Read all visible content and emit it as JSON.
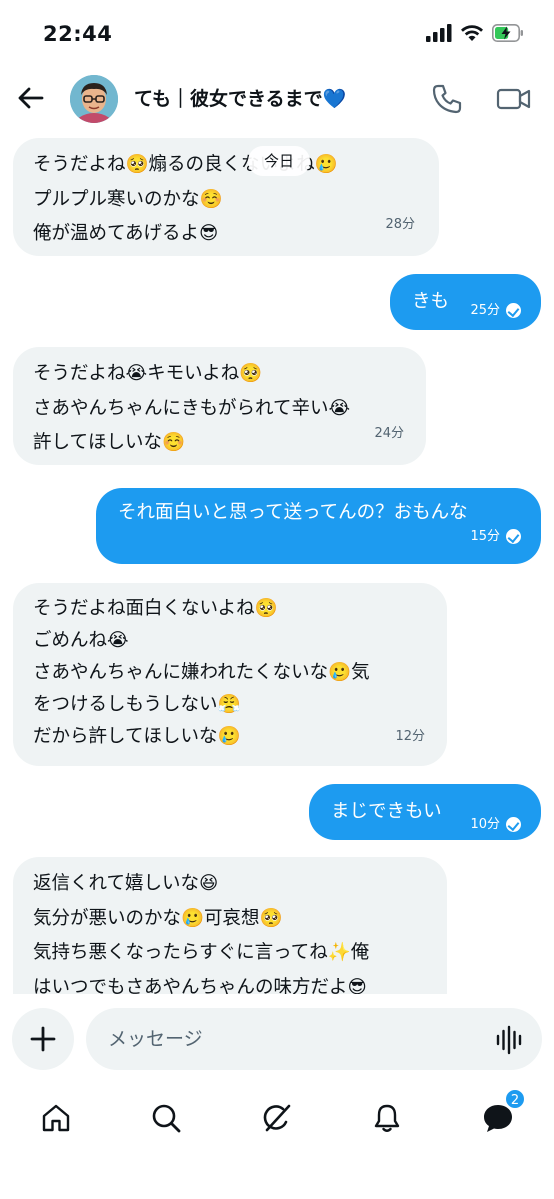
{
  "status_bar": {
    "time": "22:44",
    "battery_level": 0.6
  },
  "header": {
    "title": "ても｜彼女できるまで",
    "title_emoji": "💙",
    "icons": [
      "back-arrow-icon",
      "phone-icon",
      "video-icon"
    ]
  },
  "date_separator": "今日",
  "messages": [
    {
      "direction": "in",
      "lines": [
        "そうだよね🥺煽るの良くないよね🥲",
        "プルプル寒いのかな☺️",
        "俺が温めてあげるよ😎"
      ],
      "time": "28分"
    },
    {
      "direction": "out",
      "lines": [
        "きも"
      ],
      "time": "25分"
    },
    {
      "direction": "in",
      "lines": [
        "そうだよね😭キモいよね🥺",
        "さあやんちゃんにきもがられて辛い😭",
        "許してほしいな☺️"
      ],
      "time": "24分"
    },
    {
      "direction": "out",
      "lines": [
        "それ面白いと思って送ってんの？おもんな"
      ],
      "time": "15分"
    },
    {
      "direction": "in",
      "lines": [
        "そうだよね面白くないよね🥺",
        "ごめんね😭",
        "さあやんちゃんに嫌われたくないな🥲気",
        "をつけるしもうしない😤",
        "だから許してほしいな🥲"
      ],
      "time": "12分"
    },
    {
      "direction": "out",
      "lines": [
        "まじできもい"
      ],
      "time": "10分"
    },
    {
      "direction": "in",
      "lines": [
        "返信くれて嬉しいな😆",
        "気分が悪いのかな🥲可哀想🥺",
        "気持ち悪くなったらすぐに言ってね✨俺",
        "はいつでもさあやんちゃんの味方だよ😎"
      ],
      "time": ""
    }
  ],
  "composer": {
    "placeholder": "メッセージ"
  },
  "tabbar": {
    "items": [
      "home-icon",
      "search-icon",
      "grok-icon",
      "notifications-icon",
      "messages-icon"
    ],
    "messages_badge": "2"
  },
  "colors": {
    "accent": "#1d9bf0",
    "bubble_in": "#eff3f4",
    "text": "#0f1419",
    "muted": "#536471"
  }
}
